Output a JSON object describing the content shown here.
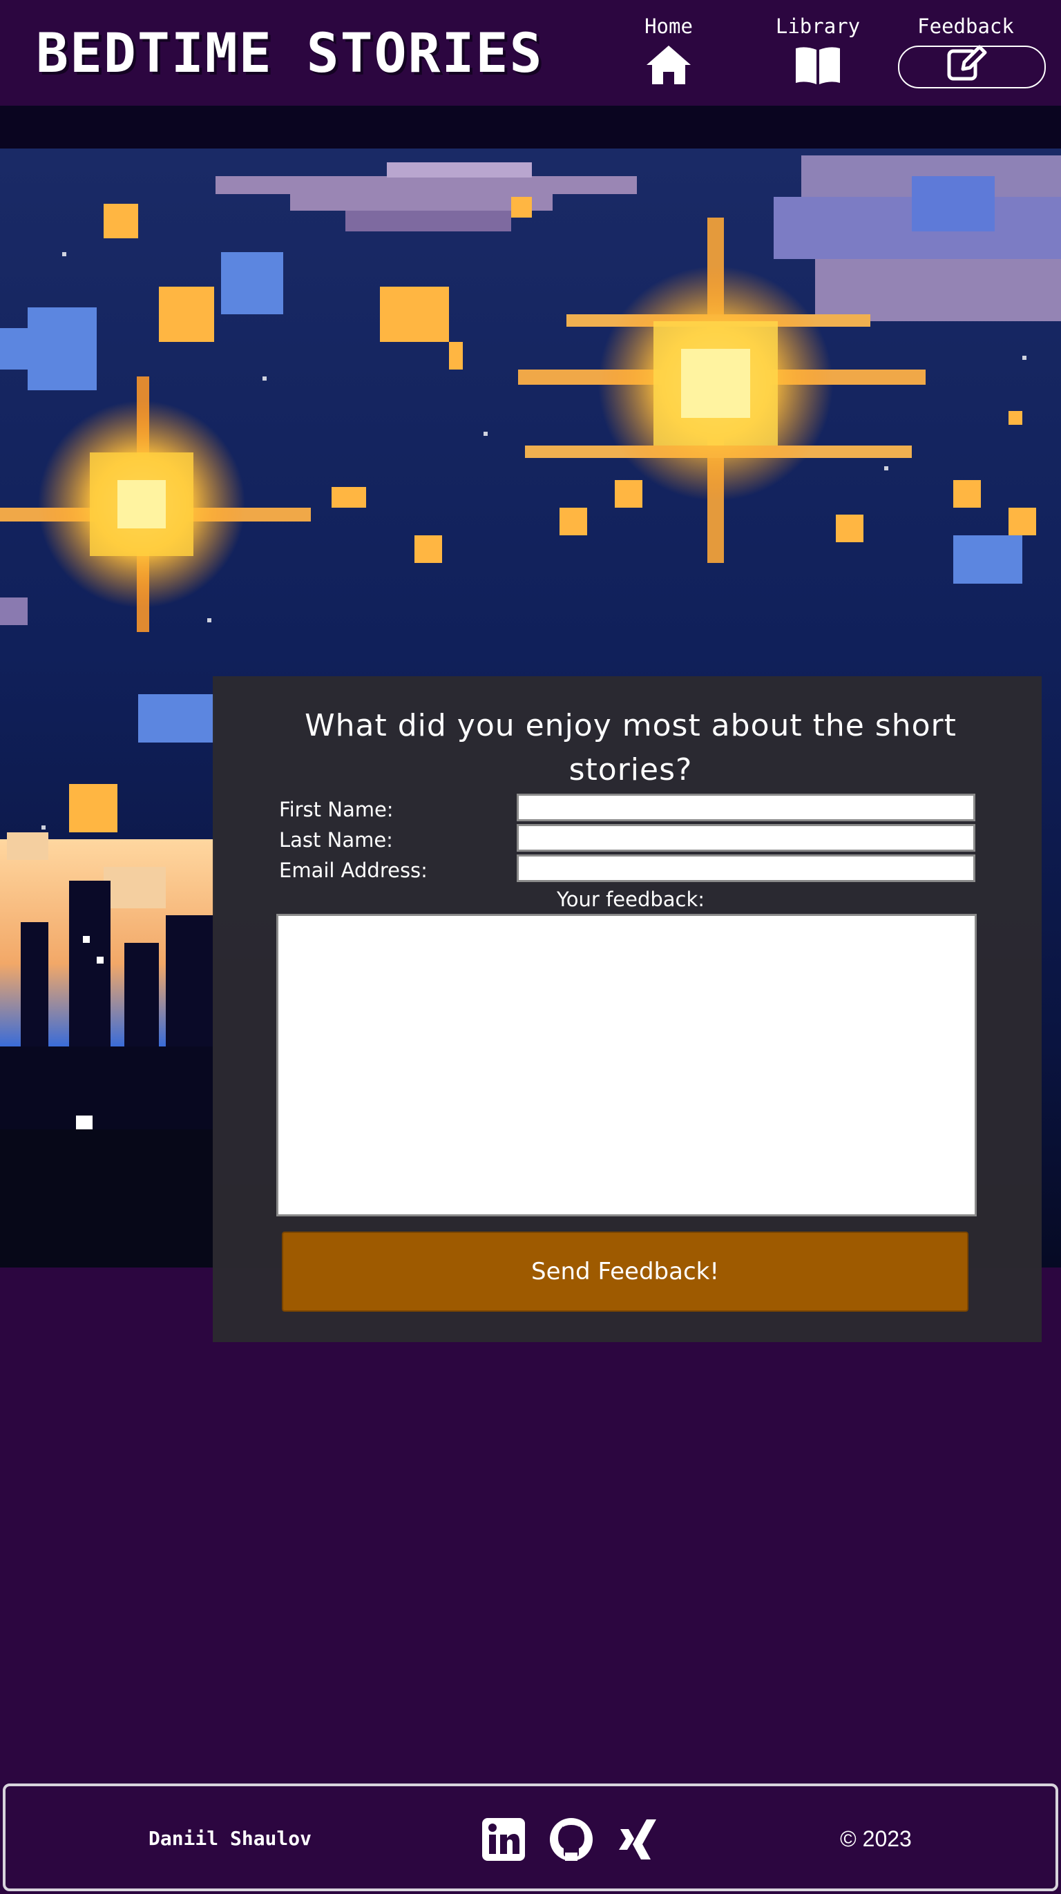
{
  "header": {
    "site_title": "BEDTIME STORIES",
    "nav": [
      {
        "label": "Home",
        "icon": "home-icon"
      },
      {
        "label": "Library",
        "icon": "book-icon"
      },
      {
        "label": "Feedback",
        "icon": "edit-icon"
      }
    ]
  },
  "form": {
    "question": "What did you enjoy most about the short stories?",
    "first_name_label": "First Name:",
    "first_name_value": "",
    "last_name_label": "Last Name:",
    "last_name_value": "",
    "email_label": "Email Address:",
    "email_value": "",
    "feedback_label": "Your feedback:",
    "feedback_value": "",
    "submit_label": "Send Feedback!"
  },
  "footer": {
    "author": "Daniil Shaulov",
    "social": [
      "linkedin-icon",
      "github-icon",
      "xing-icon"
    ],
    "copyright": "© 2023"
  },
  "colors": {
    "background": "#2c0640",
    "panel": "#2c2a30",
    "button": "#9e5a00",
    "sky": "#0f1f58",
    "star": "#ffb642"
  }
}
